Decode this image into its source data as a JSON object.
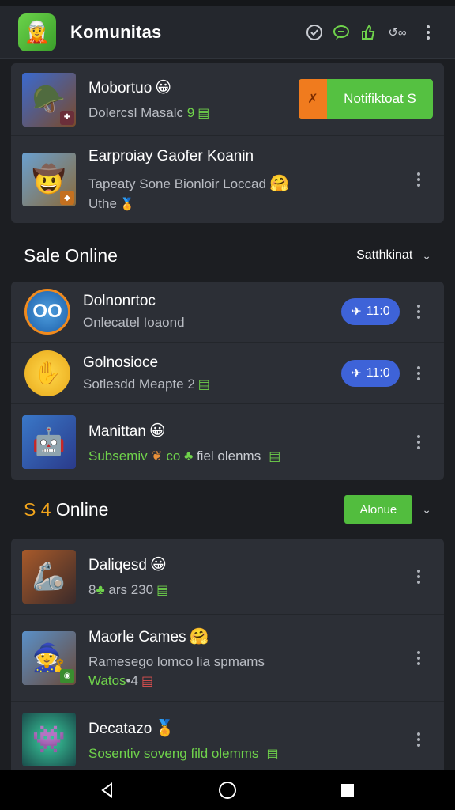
{
  "app": {
    "title": "Komunitas",
    "logo_icon": "game-character-icon"
  },
  "appbar_icons": [
    "clock-check-icon",
    "chat-bubble-icon",
    "thumbs-up-icon",
    "link-icon",
    "more-vert-icon"
  ],
  "appbar_link_text": "↺∞",
  "top_card": {
    "rows": [
      {
        "title": "Mobortuo",
        "subtitle": "Dolercsl Masalc",
        "subtitle_suffix": "9",
        "button_label": "Notifiktoat S"
      },
      {
        "title": "Earproiay Gaofer Koanin",
        "subtitle": "Tapeaty Sone Bionloir Loccad",
        "subtitle2": "Uthe"
      }
    ]
  },
  "section1": {
    "title": "Sale Online",
    "filter_label": "Satthkinat",
    "rows": [
      {
        "title": "Dolnonrtoc",
        "subtitle": "Onlecatel Ioaond",
        "pill": "11:0"
      },
      {
        "title": "Golnosioce",
        "subtitle": "Sotlesdd Meapte",
        "subtitle_suffix": "2",
        "pill": "11:0"
      },
      {
        "title": "Manittan",
        "subtitle": "Subsemiv",
        "subtitle_mid": "co",
        "subtitle_end": "fiel olenms"
      }
    ]
  },
  "section2": {
    "title_prefix": "S 4",
    "title": " Online",
    "button_label": "Alonue",
    "rows": [
      {
        "title": "Daliqesd",
        "subtitle": "8",
        "subtitle_end": "ars 230"
      },
      {
        "title": "Maorle Cames",
        "subtitle": "Ramesego lomco lia spmams",
        "subtitle2": "Watos",
        "subtitle2_end": "4"
      },
      {
        "title": "Decatazo",
        "subtitle": "Sosentiv soveng fild olemms"
      }
    ]
  },
  "nav": [
    "back-icon",
    "home-icon",
    "recents-icon"
  ],
  "colors": {
    "accent_green": "#55c141",
    "accent_orange": "#f07b1e",
    "pill_blue": "#3e63d8",
    "bg": "#1c1e22",
    "card": "#2c2f36"
  }
}
